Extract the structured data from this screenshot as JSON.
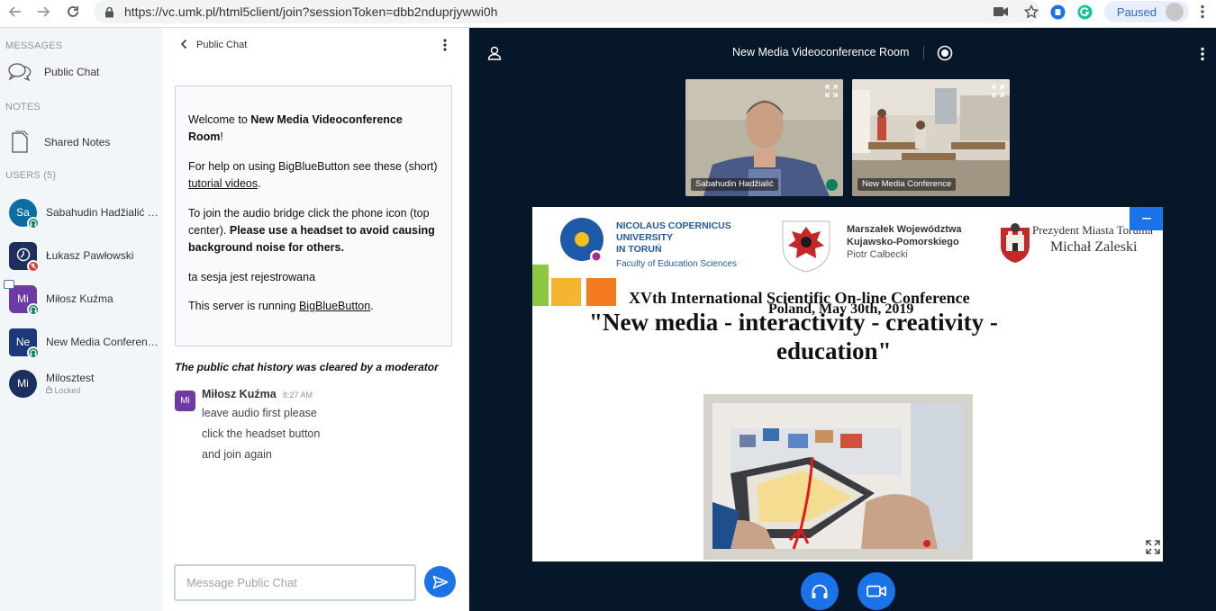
{
  "browser": {
    "url": "https://vc.umk.pl/html5client/join?sessionToken=dbb2nduprjywwi0h",
    "profile_label": "Paused"
  },
  "sidebar": {
    "messages_title": "MESSAGES",
    "public_chat_label": "Public Chat",
    "notes_title": "NOTES",
    "shared_notes_label": "Shared Notes",
    "users_title": "USERS (5)",
    "users": [
      {
        "initials": "Sa",
        "name": "Sabahudin Hadžialić (P…",
        "color": "#0b6e9f",
        "status": "",
        "badge": "audio"
      },
      {
        "initials": "",
        "name": "Łukasz Pawłowski",
        "color": "#1c2f5e",
        "status": "",
        "badge": "muted"
      },
      {
        "initials": "Mi",
        "name": "Miłosz Kuźma",
        "color": "#6e3aa3",
        "status": "",
        "badge": "audio"
      },
      {
        "initials": "Ne",
        "name": "New Media Conference",
        "color": "#1c3a7a",
        "status": "",
        "badge": "audio"
      },
      {
        "initials": "Mi",
        "name": "Milosztest",
        "color": "#1c2f5e",
        "status": "Locked",
        "badge": ""
      }
    ]
  },
  "chat": {
    "header_title": "Public Chat",
    "welcome": {
      "p1_a": "Welcome to ",
      "p1_b": "New Media Videoconference Room",
      "p1_c": "!",
      "p2_a": "For help on using BigBlueButton see these (short) ",
      "p2_link": "tutorial videos",
      "p2_c": ".",
      "p3_a": "To join the audio bridge click the phone icon (top center). ",
      "p3_b": "Please use a headset to avoid causing background noise for others.",
      "p4": "ta sesja jest rejestrowana",
      "p5_a": "This server is running ",
      "p5_link": "BigBlueButton",
      "p5_c": "."
    },
    "cleared_notice": "The public chat history was cleared by a moderator",
    "message": {
      "avatar": "Mi",
      "author": "Miłosz Kuźma",
      "time": "8:27 AM",
      "lines": [
        "leave audio first please",
        "click the headset button",
        "and join again"
      ]
    },
    "input_placeholder": "Message Public Chat"
  },
  "main": {
    "room_title": "New Media Videoconference Room",
    "cameras": [
      {
        "label": "Sabahudin Hadžialić"
      },
      {
        "label": "New Media Conference"
      }
    ],
    "slide": {
      "umk_title": [
        "NICOLAUS COPERNICUS",
        "UNIVERSITY",
        "IN TORUŃ"
      ],
      "umk_faculty": "Faculty of Education Sciences",
      "marszalek": [
        "Marszałek Województwa",
        "Kujawsko-Pomorskiego"
      ],
      "marszalek_name": "Piotr Całbecki",
      "prezydent": "Prezydent Miasta Torunia",
      "prezydent_name": "Michał Zaleski",
      "conference_title": "XVth International Scientific On-line Conference",
      "conference_date": "Poland, May 30th, 2019",
      "quote_line1": "\"New media - interactivity - creativity -",
      "quote_line2": "education\""
    }
  }
}
